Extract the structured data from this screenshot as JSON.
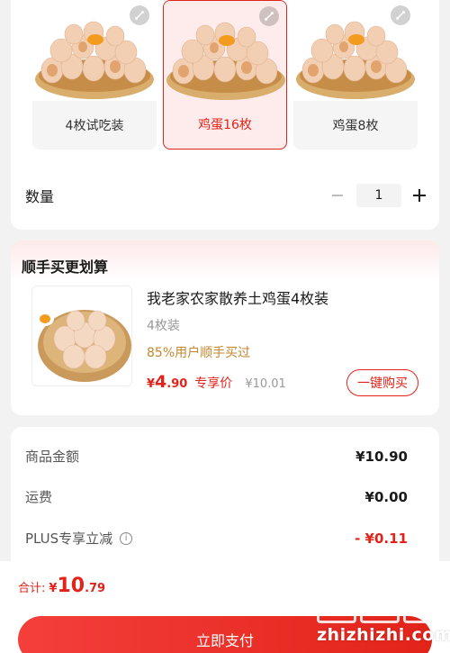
{
  "spec_options": [
    {
      "label": "4枚试吃装",
      "selected": false
    },
    {
      "label": "鸡蛋16枚",
      "selected": true
    },
    {
      "label": "鸡蛋8枚",
      "selected": false
    }
  ],
  "quantity": {
    "label": "数量",
    "value": "1"
  },
  "addon": {
    "section_title": "顺手买更划算",
    "product_name": "我老家农家散养土鸡蛋4枚装",
    "spec": "4枚装",
    "popularity": "85%用户顺手买过",
    "price_yen": "¥",
    "price_int": "4",
    "price_dec": ".90",
    "price_tag": "专享价",
    "original_price": "¥10.01",
    "buy_label": "一键购买"
  },
  "summary": {
    "goods_label": "商品金额",
    "goods_value": "¥10.90",
    "shipping_label": "运费",
    "shipping_value": "¥0.00",
    "plus_label": "PLUS专享立减",
    "plus_value": "- ¥0.11",
    "info_glyph": "i"
  },
  "footer": {
    "total_label": "合计:",
    "total_yen": "¥",
    "total_int": "10",
    "total_dec": ".79",
    "pay_label": "立即支付"
  },
  "watermark": {
    "text": "zhizhizhi.com"
  },
  "colors": {
    "accent": "#e2231a",
    "gold": "#c4872d"
  },
  "icons": [
    "expand-icon",
    "minus-icon",
    "plus-icon",
    "info-icon"
  ]
}
